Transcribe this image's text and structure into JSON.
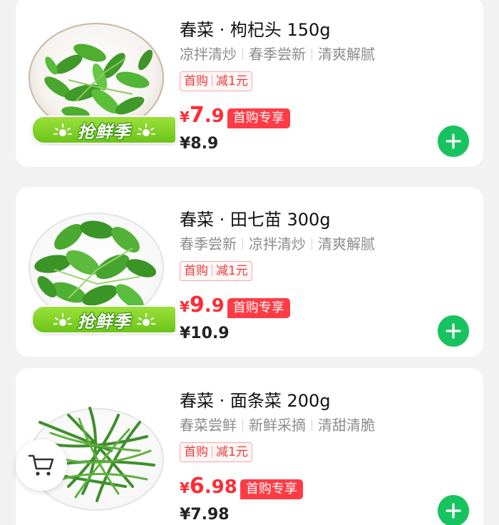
{
  "products": [
    {
      "title": "春菜 · 枸杞头 150g",
      "tags": [
        "凉拌清炒",
        "春季尝新",
        "清爽解腻"
      ],
      "coupon": {
        "first": "首购",
        "amount": "减1元"
      },
      "price": {
        "currency": "¥",
        "integer": "7",
        "decimal": ".9"
      },
      "first_buy_tag": "首购专享",
      "original_price": "¥8.9",
      "promo_banner": "抢鲜季",
      "image_icon": "leafy-greens-icon"
    },
    {
      "title": "春菜 · 田七苗 300g",
      "tags": [
        "春季尝新",
        "凉拌清炒",
        "清爽解腻"
      ],
      "coupon": {
        "first": "首购",
        "amount": "减1元"
      },
      "price": {
        "currency": "¥",
        "integer": "9",
        "decimal": ".9"
      },
      "first_buy_tag": "首购专享",
      "original_price": "¥10.9",
      "promo_banner": "抢鲜季",
      "image_icon": "leafy-greens-icon"
    },
    {
      "title": "春菜 · 面条菜 200g",
      "tags": [
        "春菜尝鲜",
        "新鲜采摘",
        "清甜清脆"
      ],
      "coupon": {
        "first": "首购",
        "amount": "减1元"
      },
      "price": {
        "currency": "¥",
        "integer": "6",
        "decimal": ".98"
      },
      "first_buy_tag": "首购专享",
      "original_price": "¥7.98",
      "image_icon": "thin-greens-icon"
    }
  ],
  "cart_button_icon": "cart-icon",
  "add_button_icon": "plus-icon",
  "colors": {
    "price_red": "#ff2b35",
    "add_green": "#17c35e",
    "promo_green": "#6cc41a",
    "coupon_red": "#e83b3b"
  }
}
